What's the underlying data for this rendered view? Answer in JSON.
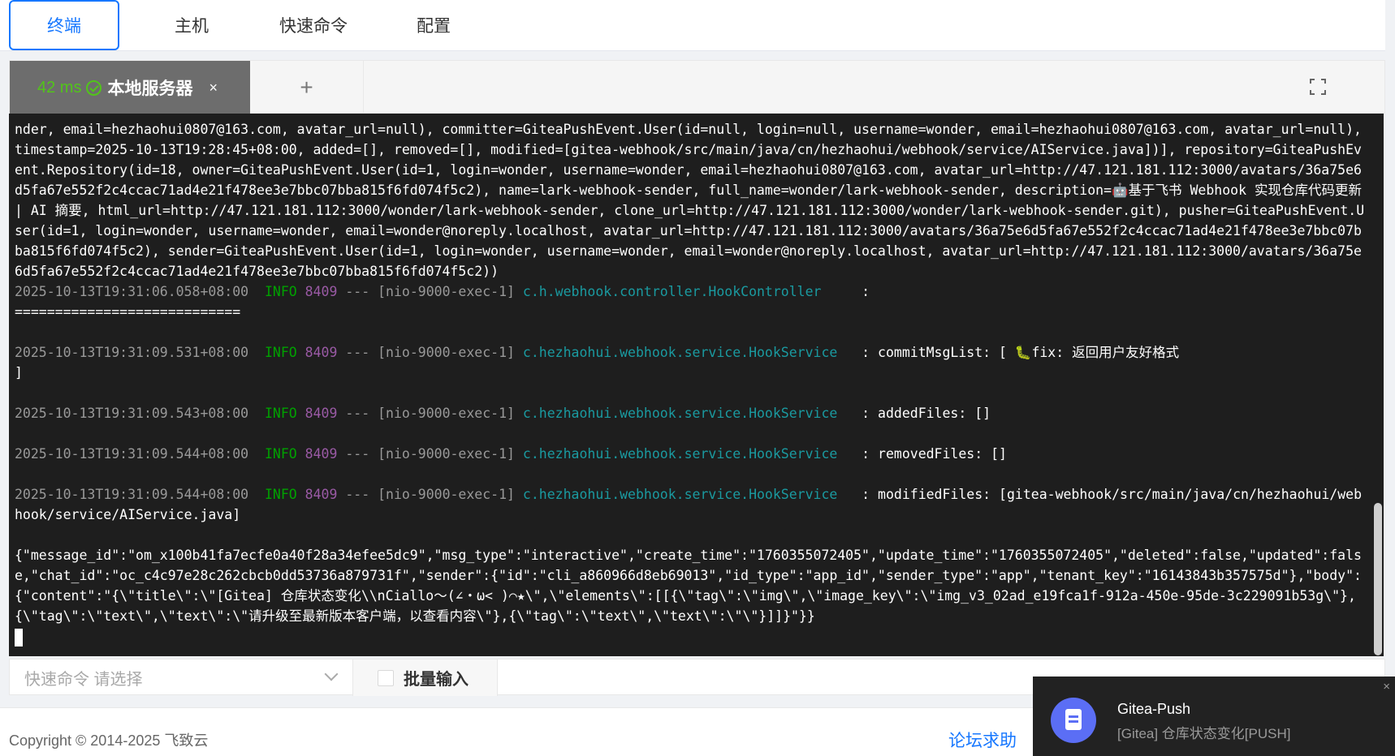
{
  "nav": {
    "tabs": [
      {
        "label": "终端",
        "active": true
      },
      {
        "label": "主机",
        "active": false
      },
      {
        "label": "快速命令",
        "active": false
      },
      {
        "label": "配置",
        "active": false
      }
    ]
  },
  "session": {
    "latency": "42 ms",
    "name": "本地服务器",
    "close_glyph": "×",
    "add_glyph": "+"
  },
  "terminal": {
    "lines": [
      {
        "text": "nder, email=hezhaohui0807@163.com, avatar_url=null), committer=GiteaPushEvent.User(id=null, login=null, username=wonder, email=hezhaohui0807@163.com, avatar_url=null), timestamp=2025-10-13T19:28:45+08:00, added=[], removed=[], modified=[gitea-webhook/src/main/java/cn/hezhaohui/webhook/service/AIService.java])], repository=GiteaPushEvent.Repository(id=18, owner=GiteaPushEvent.User(id=1, login=wonder, username=wonder, email=hezhaohui0807@163.com, avatar_url=http://47.121.181.112:3000/avatars/36a75e6d5fa67e552f2c4ccac71ad4e21f478ee3e7bbc07bba815f6fd074f5c2), name=lark-webhook-sender, full_name=wonder/lark-webhook-sender, description=🤖基于飞书 Webhook 实现仓库代码更新 | AI 摘要, html_url=http://47.121.181.112:3000/wonder/lark-webhook-sender, clone_url=http://47.121.181.112:3000/wonder/lark-webhook-sender.git), pusher=GiteaPushEvent.User(id=1, login=wonder, username=wonder, email=wonder@noreply.localhost, avatar_url=http://47.121.181.112:3000/avatars/36a75e6d5fa67e552f2c4ccac71ad4e21f478ee3e7bbc07bba815f6fd074f5c2), sender=GiteaPushEvent.User(id=1, login=wonder, username=wonder, email=wonder@noreply.localhost, avatar_url=http://47.121.181.112:3000/avatars/36a75e6d5fa67e552f2c4ccac71ad4e21f478ee3e7bbc07bba815f6fd074f5c2))"
      },
      {
        "ts": "2025-10-13T19:31:06.058+08:00",
        "level": "INFO",
        "pid": "8409",
        "dash": "---",
        "thread": "[nio-9000-exec-1]",
        "logger": "c.h.webhook.controller.HookController    ",
        "msg": ":"
      },
      {
        "text": "============================"
      },
      {
        "blank": true
      },
      {
        "ts": "2025-10-13T19:31:09.531+08:00",
        "level": "INFO",
        "pid": "8409",
        "dash": "---",
        "thread": "[nio-9000-exec-1]",
        "logger": "c.hezhaohui.webhook.service.HookService  ",
        "msg": ": commitMsgList: [ 🐛fix: 返回用户友好格式"
      },
      {
        "text": "]"
      },
      {
        "blank": true
      },
      {
        "ts": "2025-10-13T19:31:09.543+08:00",
        "level": "INFO",
        "pid": "8409",
        "dash": "---",
        "thread": "[nio-9000-exec-1]",
        "logger": "c.hezhaohui.webhook.service.HookService  ",
        "msg": ": addedFiles: []"
      },
      {
        "blank": true
      },
      {
        "ts": "2025-10-13T19:31:09.544+08:00",
        "level": "INFO",
        "pid": "8409",
        "dash": "---",
        "thread": "[nio-9000-exec-1]",
        "logger": "c.hezhaohui.webhook.service.HookService  ",
        "msg": ": removedFiles: []"
      },
      {
        "blank": true
      },
      {
        "ts": "2025-10-13T19:31:09.544+08:00",
        "level": "INFO",
        "pid": "8409",
        "dash": "---",
        "thread": "[nio-9000-exec-1]",
        "logger": "c.hezhaohui.webhook.service.HookService  ",
        "msg": ": modifiedFiles: [gitea-webhook/src/main/java/cn/hezhaohui/webhook/service/AIService.java]"
      },
      {
        "blank": true
      },
      {
        "text": "{\"message_id\":\"om_x100b41fa7ecfe0a40f28a34efee5dc9\",\"msg_type\":\"interactive\",\"create_time\":\"1760355072405\",\"update_time\":\"1760355072405\",\"deleted\":false,\"updated\":false,\"chat_id\":\"oc_c4c97e28c262cbcb0dd53736a879731f\",\"sender\":{\"id\":\"cli_a860966d8eb69013\",\"id_type\":\"app_id\",\"sender_type\":\"app\",\"tenant_key\":\"16143843b357575d\"},\"body\":{\"content\":\"{\\\"title\\\":\\\"[Gitea] 仓库状态变化\\\\nCiallo～(∠・ω< )⌒★\\\",\\\"elements\\\":[[{\\\"tag\\\":\\\"img\\\",\\\"image_key\\\":\\\"img_v3_02ad_e19fca1f-912a-450e-95de-3c229091b53g\\\"},{\\\"tag\\\":\\\"text\\\",\\\"text\\\":\\\"请升级至最新版本客户端，以查看内容\\\"},{\\\"tag\\\":\\\"text\\\",\\\"text\\\":\\\"\\\"}]]}\"}}"
      },
      {
        "cursor": true
      }
    ]
  },
  "cmdbar": {
    "quick_command_placeholder": "快速命令  请选择",
    "batch_label": "批量输入"
  },
  "footer": {
    "copyright": "Copyright © 2014-2025 飞致云",
    "help_link": "论坛求助"
  },
  "notification": {
    "title": "Gitea-Push",
    "body": "[Gitea] 仓库状态变化[PUSH]",
    "close_glyph": "×"
  },
  "colors": {
    "accent": "#1677ff",
    "terminal_bg": "#1e1e1e",
    "log_level": "#00a000",
    "log_pid": "#9a5aa5",
    "log_logger": "#1a9aa0",
    "latency_ok": "#52c41a",
    "toast_icon": "#5b6ef5"
  }
}
